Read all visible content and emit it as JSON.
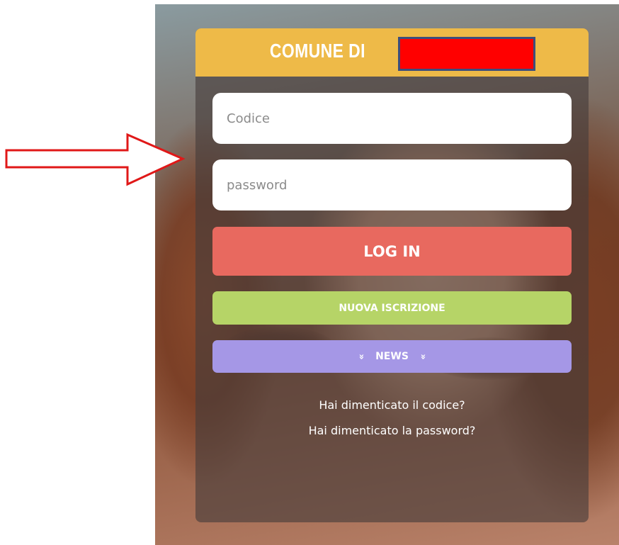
{
  "header": {
    "brand_prefix": "COMUNE DI"
  },
  "login_form": {
    "code_placeholder": "Codice",
    "password_placeholder": "password",
    "login_label": "LOG IN",
    "signup_label": "NUOVA ISCRIZIONE",
    "news_label": "NEWS",
    "forgot_code_label": "Hai dimenticato il codice?",
    "forgot_password_label": "Hai dimenticato la password?"
  },
  "colors": {
    "header": "#eeba48",
    "login": "#e8695f",
    "signup": "#b6d467",
    "news": "#a597e6",
    "annotation_arrow": "#e01818",
    "redaction": "#ff0000"
  },
  "icons": {
    "news_decoration": "double-chevron-down-icon",
    "annotation": "right-arrow-icon"
  }
}
